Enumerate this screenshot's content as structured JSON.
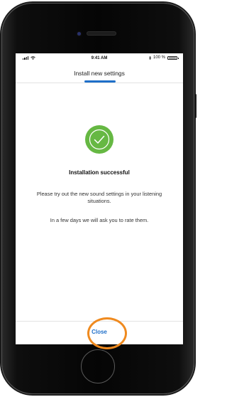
{
  "statusbar": {
    "time": "9:41 AM",
    "battery_text": "100 %"
  },
  "header": {
    "title": "Install new settings"
  },
  "result": {
    "title": "Installation successful",
    "message_1": "Please try out the new sound settings in your listening situations.",
    "message_2": "In a few days we will ask you to rate them.",
    "check_color": "#66b843"
  },
  "footer": {
    "close_label": "Close"
  },
  "colors": {
    "accent": "#1f6fc9",
    "highlight": "#ef8a1f"
  },
  "icons": [
    "camera-icon",
    "signal-icon",
    "wifi-icon",
    "battery-icon",
    "checkmark-icon",
    "home-button"
  ]
}
